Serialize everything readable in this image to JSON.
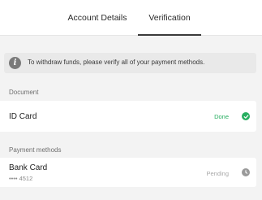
{
  "tabs": [
    {
      "label": "Account Details",
      "active": false
    },
    {
      "label": "Verification",
      "active": true
    }
  ],
  "info": {
    "icon": "info-icon",
    "text": "To withdraw funds, please verify all of your payment methods."
  },
  "sections": {
    "document": "Document",
    "payment": "Payment methods"
  },
  "document_items": [
    {
      "title": "ID Card",
      "status": "Done",
      "status_icon": "check-circle-icon",
      "status_color": "#27ae60"
    }
  ],
  "payment_items": [
    {
      "title": "Bank Card",
      "masked_number": "•••• 4512",
      "status": "Pending",
      "status_icon": "clock-icon",
      "status_color": "#a9a9a9"
    }
  ]
}
